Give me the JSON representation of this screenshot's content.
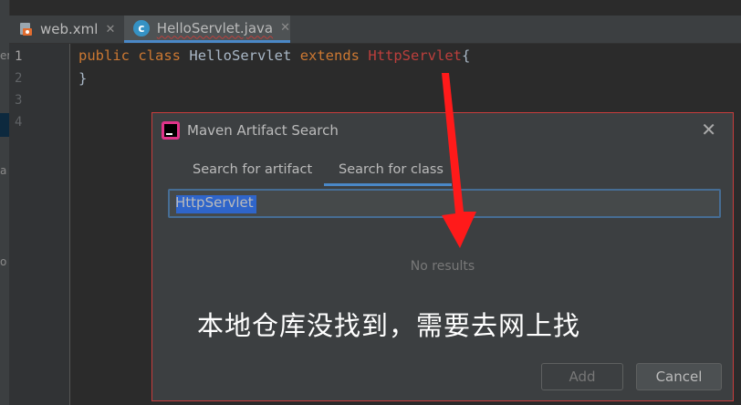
{
  "colors": {
    "accent": "#4a88c7",
    "error": "#bc3f3c",
    "keyword": "#cc7832",
    "annotation_arrow": "#ff1a1a"
  },
  "left_strip": {
    "labels": [
      "er",
      "a",
      "o"
    ]
  },
  "editor_tabs": [
    {
      "label": "web.xml",
      "icon": "xml-file-icon",
      "active": false
    },
    {
      "label": "HelloServlet.java",
      "icon": "class-c-icon",
      "active": true
    }
  ],
  "editor": {
    "line_numbers": [
      "1",
      "2",
      "3",
      "4"
    ],
    "lines": [
      {
        "kw1": "public",
        "kw2": "class",
        "name": "HelloServlet",
        "kw3": "extends",
        "super": "HttpServlet",
        "brace": "{"
      },
      {
        "text": "}"
      }
    ]
  },
  "dialog": {
    "title": "Maven Artifact Search",
    "tabs": [
      "Search for artifact",
      "Search for class"
    ],
    "active_tab": "Search for class",
    "search_value": "HttpServlet",
    "empty_text": "No results",
    "buttons": {
      "add": "Add",
      "cancel": "Cancel"
    }
  },
  "annotation": {
    "text": "本地仓库没找到，需要去网上找"
  }
}
